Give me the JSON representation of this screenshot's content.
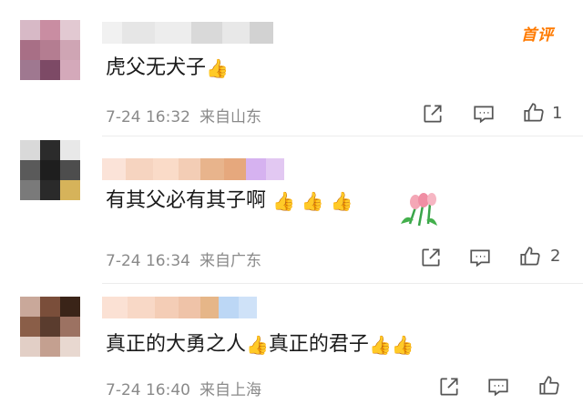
{
  "comments": [
    {
      "text": "虎父无犬子",
      "emoji": [
        "👍"
      ],
      "time": "7-24 16:32",
      "location": "来自山东",
      "likes": "1",
      "badge": "首评"
    },
    {
      "text": "有其父必有其子啊",
      "emoji": [
        "👍",
        "👍",
        "👍"
      ],
      "time": "7-24 16:34",
      "location": "来自广东",
      "likes": "2",
      "decoration": "tulip-bouquet"
    },
    {
      "text_a": "真正的大勇之人",
      "text_b": "真正的君子",
      "emoji": [
        "👍",
        "👍",
        "👍"
      ],
      "time": "7-24 16:40",
      "location": "来自上海",
      "likes": ""
    }
  ],
  "icons": {
    "share": "share-icon",
    "comment": "comment-icon",
    "like": "thumbs-up-icon"
  },
  "colors": {
    "badge": "#ff7a00",
    "meta": "#8a8a8a",
    "text": "#1a1a1a"
  }
}
